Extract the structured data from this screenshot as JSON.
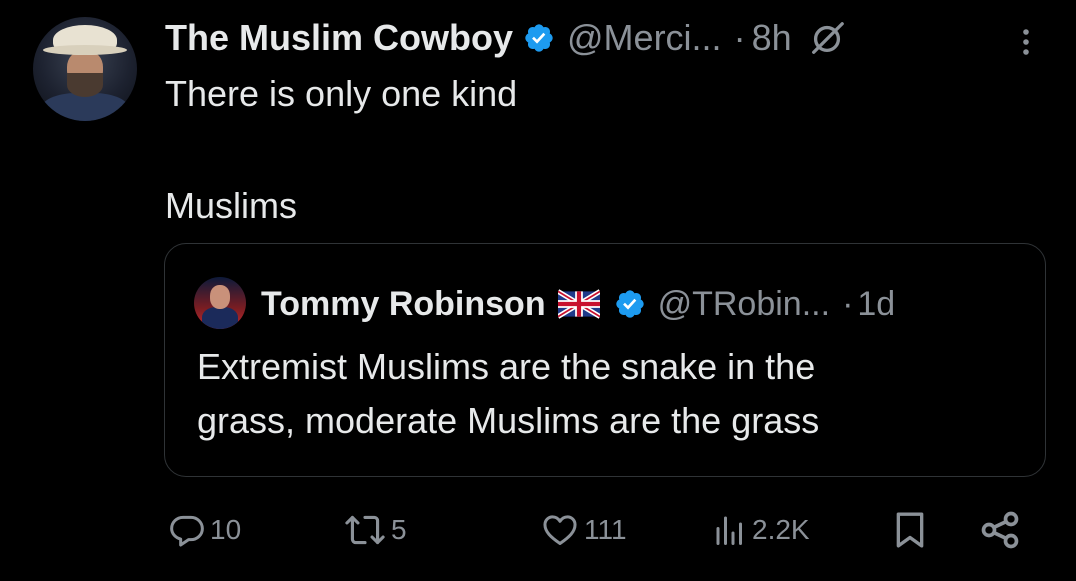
{
  "post": {
    "author_name": "The Muslim Cowboy",
    "handle": "@Merci...",
    "dot": "·",
    "time": "8h",
    "text": "There is only one kind\n\nMuslims"
  },
  "quote": {
    "author_name": "Tommy Robinson",
    "handle": "@TRobin...",
    "dot": "·",
    "time": "1d",
    "text": "Extremist Muslims are the snake in the\ngrass, moderate Muslims are the grass"
  },
  "actions": {
    "replies": "10",
    "reposts": "5",
    "likes": "111",
    "views": "2.2K"
  },
  "icons": {
    "verified": "verified-badge-icon",
    "grok": "grok-icon",
    "more": "more-vertical-icon",
    "flag": "uk-flag-icon",
    "reply": "reply-icon",
    "repost": "repost-icon",
    "like": "heart-icon",
    "views": "views-icon",
    "bookmark": "bookmark-icon",
    "share": "share-icon"
  },
  "colors": {
    "background": "#000000",
    "text": "#e7e9ea",
    "secondary": "#8b9198",
    "verified": "#1d9bf0",
    "border": "#2f3336"
  }
}
